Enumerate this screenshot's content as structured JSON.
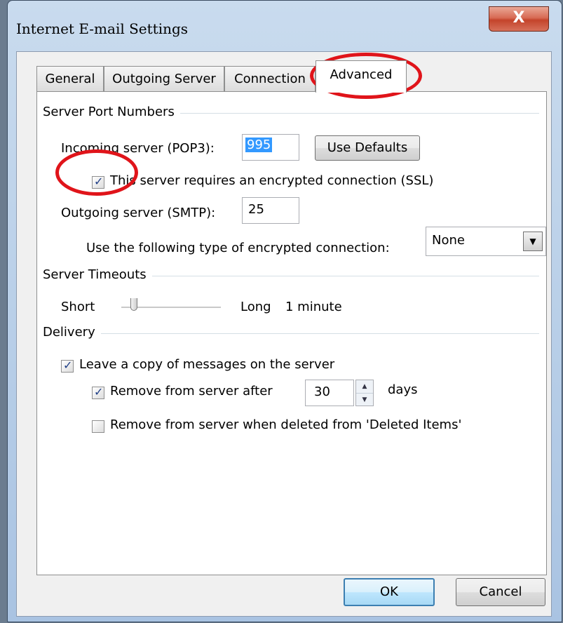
{
  "window": {
    "title": "Internet E-mail Settings",
    "close_glyph": "X"
  },
  "tabs": [
    {
      "label": "General",
      "active": false
    },
    {
      "label": "Outgoing Server",
      "active": false
    },
    {
      "label": "Connection",
      "active": false
    },
    {
      "label": "Advanced",
      "active": true
    }
  ],
  "port_numbers": {
    "group_label": "Server Port Numbers",
    "incoming_label": "Incoming server (POP3):",
    "incoming_value": "995",
    "use_defaults_label": "Use Defaults",
    "ssl_label": "This server requires an encrypted connection (SSL)",
    "ssl_checked": true,
    "outgoing_label": "Outgoing server (SMTP):",
    "outgoing_value": "25",
    "encryption_label": "Use the following type of encrypted connection:",
    "encryption_value": "None"
  },
  "timeouts": {
    "group_label": "Server Timeouts",
    "short_label": "Short",
    "long_label": "Long",
    "value_text": "1 minute",
    "level": 0.1
  },
  "delivery": {
    "group_label": "Delivery",
    "leave_copy_label": "Leave a copy of messages on the server",
    "leave_copy_checked": true,
    "remove_after_label": "Remove from server after",
    "remove_after_checked": true,
    "remove_after_value": "30",
    "days_label": "days",
    "remove_deleted_label": "Remove from server when deleted from 'Deleted Items'",
    "remove_deleted_checked": false
  },
  "buttons": {
    "ok_label": "OK",
    "cancel_label": "Cancel"
  },
  "colors": {
    "annotation_red": "#e0141a",
    "selection_blue": "#3399ff"
  }
}
